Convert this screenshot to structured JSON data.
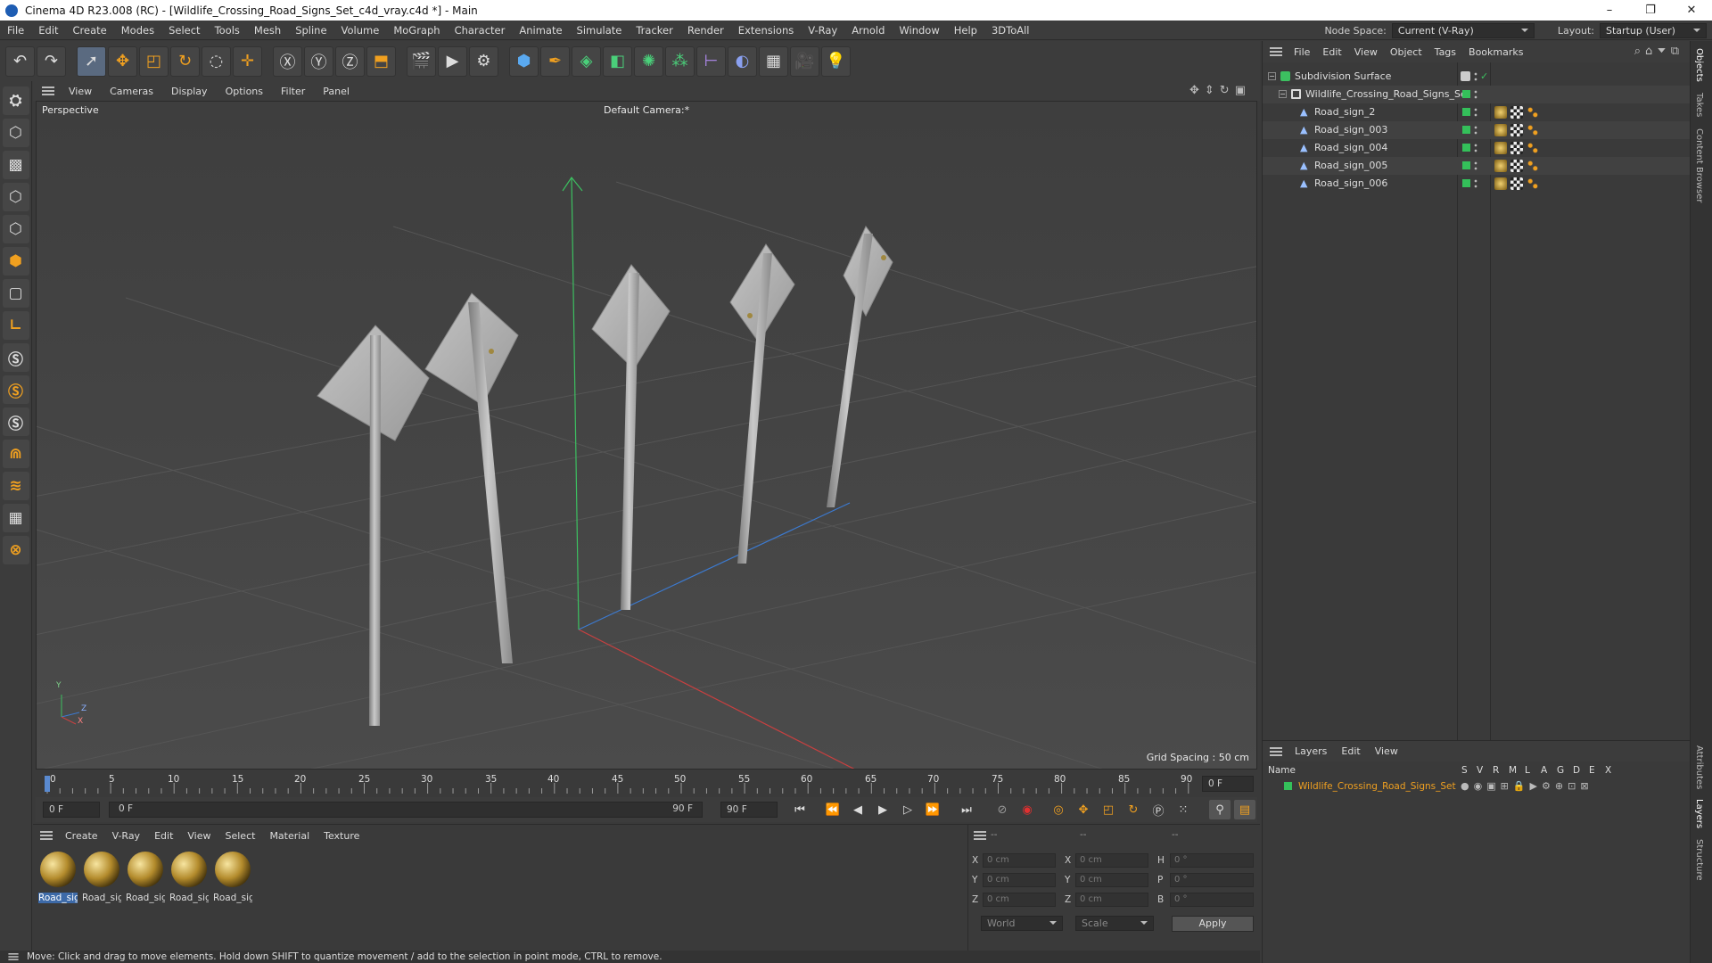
{
  "window": {
    "title": "Cinema 4D R23.008 (RC) - [Wildlife_Crossing_Road_Signs_Set_c4d_vray.c4d *] - Main",
    "controls": {
      "minimize": "–",
      "maximize": "❐",
      "close": "✕"
    }
  },
  "menubar": {
    "items": [
      "File",
      "Edit",
      "Create",
      "Modes",
      "Select",
      "Tools",
      "Mesh",
      "Spline",
      "Volume",
      "MoGraph",
      "Character",
      "Animate",
      "Simulate",
      "Tracker",
      "Render",
      "Extensions",
      "V-Ray",
      "Arnold",
      "Window",
      "Help",
      "3DToAll"
    ],
    "node_space_label": "Node Space:",
    "node_space_value": "Current (V-Ray)",
    "layout_label": "Layout:",
    "layout_value": "Startup (User)"
  },
  "viewport": {
    "menu": [
      "View",
      "Cameras",
      "Display",
      "Options",
      "Filter",
      "Panel"
    ],
    "view_name": "Perspective",
    "camera": "Default Camera",
    "camera_suffix": ":*",
    "grid_spacing": "Grid Spacing : 50 cm",
    "axis_y": "Y",
    "axis_z": "Z",
    "axis_x": "X"
  },
  "timeline": {
    "ticks": [
      "0",
      "5",
      "10",
      "15",
      "20",
      "25",
      "30",
      "35",
      "40",
      "45",
      "50",
      "55",
      "60",
      "65",
      "70",
      "75",
      "80",
      "85",
      "90"
    ],
    "current_frame": "0 F",
    "start_frame": "0 F",
    "range_start": "0 F",
    "range_end": "90 F",
    "end_frame": "90 F"
  },
  "materials": {
    "menu": [
      "Create",
      "V-Ray",
      "Edit",
      "View",
      "Select",
      "Material",
      "Texture"
    ],
    "items": [
      {
        "name": "Road_sig",
        "selected": true
      },
      {
        "name": "Road_sig",
        "selected": false
      },
      {
        "name": "Road_sig",
        "selected": false
      },
      {
        "name": "Road_sig",
        "selected": false
      },
      {
        "name": "Road_sig",
        "selected": false
      }
    ]
  },
  "coordinates": {
    "headers": [
      "--",
      "--",
      "--"
    ],
    "rows": [
      {
        "a_label": "X",
        "a_val": "0 cm",
        "b_label": "X",
        "b_val": "0 cm",
        "c_label": "H",
        "c_val": "0 °"
      },
      {
        "a_label": "Y",
        "a_val": "0 cm",
        "b_label": "Y",
        "b_val": "0 cm",
        "c_label": "P",
        "c_val": "0 °"
      },
      {
        "a_label": "Z",
        "a_val": "0 cm",
        "b_label": "Z",
        "b_val": "0 cm",
        "c_label": "B",
        "c_val": "0 °"
      }
    ],
    "space": "World",
    "mode": "Scale",
    "apply": "Apply"
  },
  "status": {
    "text": "Move: Click and drag to move elements. Hold down SHIFT to quantize movement / add to the selection in point mode, CTRL to remove."
  },
  "objects": {
    "menu": [
      "File",
      "Edit",
      "View",
      "Object",
      "Tags",
      "Bookmarks"
    ],
    "items": [
      {
        "name": "Subdivision Surface",
        "indent": 0
      },
      {
        "name": "Wildlife_Crossing_Road_Signs_Set",
        "indent": 1
      },
      {
        "name": "Road_sign_2",
        "indent": 2
      },
      {
        "name": "Road_sign_003",
        "indent": 2
      },
      {
        "name": "Road_sign_004",
        "indent": 2
      },
      {
        "name": "Road_sign_005",
        "indent": 2
      },
      {
        "name": "Road_sign_006",
        "indent": 2
      }
    ]
  },
  "layers": {
    "menu": [
      "Layers",
      "Edit",
      "View"
    ],
    "name_header": "Name",
    "flag_headers": [
      "S",
      "V",
      "R",
      "M",
      "L",
      "A",
      "G",
      "D",
      "E",
      "X"
    ],
    "items": [
      {
        "name": "Wildlife_Crossing_Road_Signs_Set",
        "color": "#34c05a"
      }
    ]
  },
  "sidetabs": [
    "Objects",
    "Takes",
    "Content Browser",
    "Attributes",
    "Layers",
    "Structure"
  ],
  "colors": {
    "accent_green": "#34c05a",
    "selection_blue": "#3d6aa8",
    "orange": "#f0a020"
  }
}
